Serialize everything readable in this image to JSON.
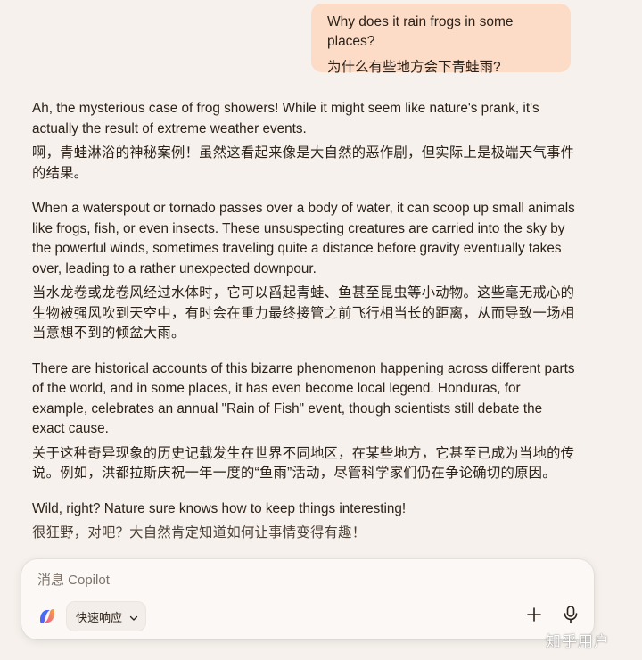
{
  "user_message": {
    "en": "Why does it rain frogs in some places?",
    "zh": "为什么有些地方会下青蛙雨?"
  },
  "assistant_paragraphs": [
    {
      "en": "Ah, the mysterious case of frog showers! While it might seem like nature's prank, it's actually the result of extreme weather events.",
      "zh": "啊，青蛙淋浴的神秘案例！虽然这看起来像是大自然的恶作剧，但实际上是极端天气事件的结果。"
    },
    {
      "en": "When a waterspout or tornado passes over a body of water, it can scoop up small animals like frogs, fish, or even insects. These unsuspecting creatures are carried into the sky by the powerful winds, sometimes traveling quite a distance before gravity eventually takes over, leading to a rather unexpected downpour.",
      "zh": "当水龙卷或龙卷风经过水体时，它可以舀起青蛙、鱼甚至昆虫等小动物。这些毫无戒心的生物被强风吹到天空中，有时会在重力最终接管之前飞行相当长的距离，从而导致一场相当意想不到的倾盆大雨。"
    },
    {
      "en": "There are historical accounts of this bizarre phenomenon happening across different parts of the world, and in some places, it has even become local legend. Honduras, for example, celebrates an annual \"Rain of Fish\" event, though scientists still debate the exact cause.",
      "zh": "关于这种奇异现象的历史记载发生在世界不同地区，在某些地方，它甚至已成为当地的传说。例如，洪都拉斯庆祝一年一度的“鱼雨”活动，尽管科学家们仍在争论确切的原因。"
    },
    {
      "en": "Wild, right? Nature sure knows how to keep things interesting!",
      "zh": "很狂野，对吧？大自然肯定知道如何让事情变得有趣！"
    }
  ],
  "composer": {
    "placeholder": "消息 Copilot",
    "value": "",
    "mode_label": "快速响应"
  },
  "icons": {
    "copilot": "copilot-logo-icon",
    "chevron": "chevron-down-icon",
    "plus": "plus-icon",
    "mic": "microphone-icon"
  },
  "watermark": "知乎用户",
  "colors": {
    "background": "#f6f1ec",
    "user_bubble": "#fcdcc7",
    "composer": "#fbf8f5",
    "text": "#2b2118"
  }
}
